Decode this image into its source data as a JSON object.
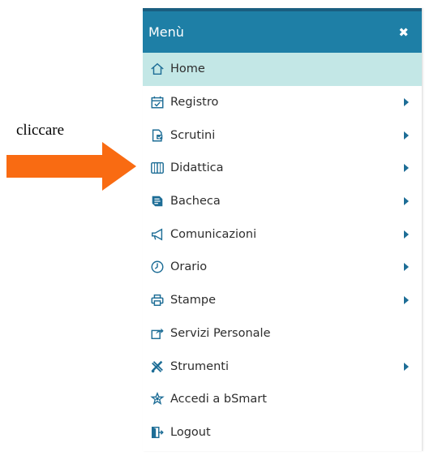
{
  "annotation": {
    "text": "cliccare",
    "arrow_color": "#f96b12"
  },
  "menu": {
    "title": "Menù",
    "close_icon": "close-icon",
    "colors": {
      "header": "#1e7fa6",
      "active": "#c3e7e6",
      "icon": "#1d6d96"
    },
    "items": [
      {
        "label": "Home",
        "icon": "home-icon",
        "active": true,
        "submenu": false
      },
      {
        "label": "Registro",
        "icon": "calendar-check-icon",
        "active": false,
        "submenu": true
      },
      {
        "label": "Scrutini",
        "icon": "scrutini-doc-icon",
        "active": false,
        "submenu": true
      },
      {
        "label": "Didattica",
        "icon": "book-open-icon",
        "active": false,
        "submenu": true
      },
      {
        "label": "Bacheca",
        "icon": "bacheca-icon",
        "active": false,
        "submenu": true
      },
      {
        "label": "Comunicazioni",
        "icon": "megaphone-icon",
        "active": false,
        "submenu": true
      },
      {
        "label": "Orario",
        "icon": "clock-icon",
        "active": false,
        "submenu": true
      },
      {
        "label": "Stampe",
        "icon": "printer-icon",
        "active": false,
        "submenu": true
      },
      {
        "label": "Servizi Personale",
        "icon": "share-icon",
        "active": false,
        "submenu": false
      },
      {
        "label": "Strumenti",
        "icon": "tools-icon",
        "active": false,
        "submenu": true
      },
      {
        "label": "Accedi a bSmart",
        "icon": "bsmart-icon",
        "active": false,
        "submenu": false
      },
      {
        "label": "Logout",
        "icon": "logout-icon",
        "active": false,
        "submenu": false
      }
    ]
  }
}
